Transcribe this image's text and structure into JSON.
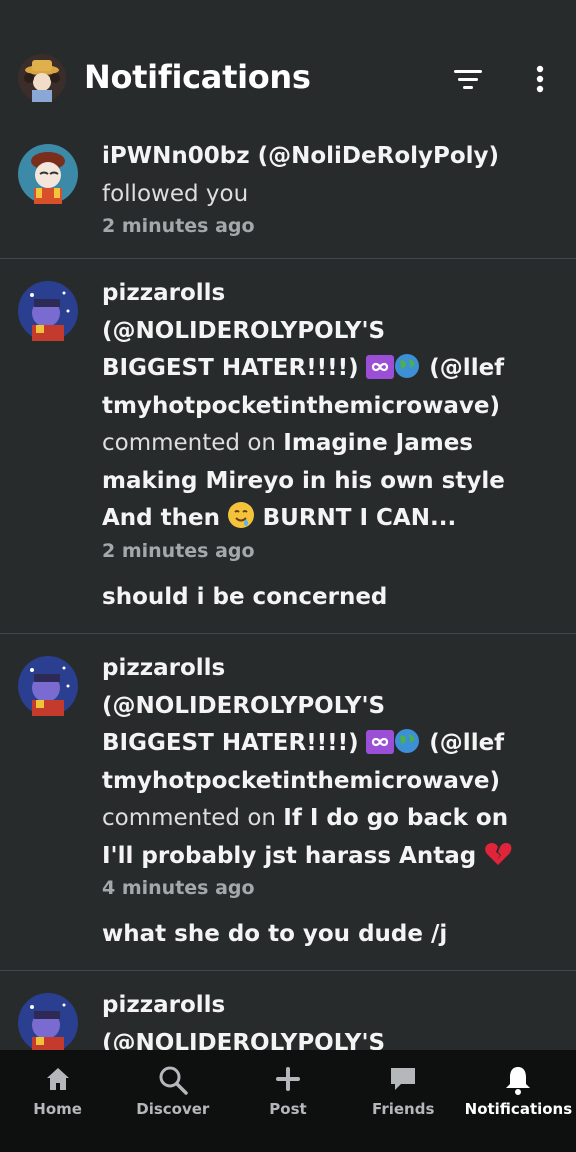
{
  "header": {
    "title": "Notifications",
    "avatar_icon": "user-avatar",
    "filter_icon": "filter-icon",
    "menu_icon": "more-vertical-icon"
  },
  "notifications": [
    {
      "actor": "iPWNn00bz (@NoliDeRolyPoly)",
      "action": "followed you",
      "time": "2 minutes ago"
    },
    {
      "actor_line1": "pizzarolls",
      "actor_line2": "(@NOLIDEROLYPOLY'S",
      "actor_line3a": "BIGGEST HATER!!!!)",
      "actor_line3b": "(@llef",
      "actor_line4": "tmyhotpocketinthemicrowave)",
      "action": "commented on",
      "post_title_a": "Imagine James",
      "post_title_b": "making Mireyo in his own style",
      "post_title_c1": "And then",
      "post_title_c2": "BURNT I CAN...",
      "time": "2 minutes ago",
      "comment": "should i be concerned"
    },
    {
      "actor_line1": "pizzarolls",
      "actor_line2": "(@NOLIDEROLYPOLY'S",
      "actor_line3a": "BIGGEST HATER!!!!)",
      "actor_line3b": "(@llef",
      "actor_line4": "tmyhotpocketinthemicrowave)",
      "action": "commented on",
      "post_title_a": "If I do go back on",
      "post_title_b": "I'll probably jst harass Antag",
      "time": "4 minutes ago",
      "comment": "what she do to you dude /j"
    },
    {
      "actor_line1": "pizzarolls",
      "actor_line2": "(@NOLIDEROLYPOLY'S"
    }
  ],
  "bottom_nav": [
    {
      "label": "Home",
      "icon": "home-icon"
    },
    {
      "label": "Discover",
      "icon": "search-icon"
    },
    {
      "label": "Post",
      "icon": "plus-icon"
    },
    {
      "label": "Friends",
      "icon": "chat-icon"
    },
    {
      "label": "Notifications",
      "icon": "bell-icon",
      "active": true
    }
  ],
  "colors": {
    "background": "#272b2b",
    "divider": "#40464a",
    "nav_background": "#0e0f0f",
    "muted_text": "#a3a8ab"
  }
}
